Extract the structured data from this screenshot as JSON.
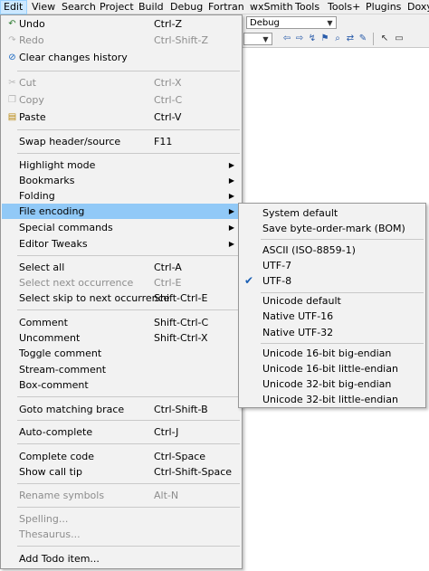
{
  "menubar": {
    "items": [
      "Edit",
      "View",
      "Search",
      "Project",
      "Build",
      "Debug",
      "Fortran",
      "wxSmith",
      "Tools",
      "Tools+",
      "Plugins",
      "Doxy"
    ]
  },
  "toolbar": {
    "build_target": "Debug"
  },
  "edit_menu": {
    "items": [
      {
        "label": "Undo",
        "shortcut": "Ctrl-Z",
        "icon": "undo-icon",
        "enabled": true
      },
      {
        "label": "Redo",
        "shortcut": "Ctrl-Shift-Z",
        "icon": "redo-icon",
        "enabled": false
      },
      {
        "label": "Clear changes history",
        "shortcut": "",
        "icon": "clear-history-icon",
        "enabled": true
      },
      {
        "label": "Cut",
        "shortcut": "Ctrl-X",
        "icon": "cut-icon",
        "enabled": false
      },
      {
        "label": "Copy",
        "shortcut": "Ctrl-C",
        "icon": "copy-icon",
        "enabled": false
      },
      {
        "label": "Paste",
        "shortcut": "Ctrl-V",
        "icon": "paste-icon",
        "enabled": true
      },
      {
        "label": "Swap header/source",
        "shortcut": "F11",
        "enabled": true
      },
      {
        "label": "Highlight mode",
        "shortcut": "",
        "enabled": true,
        "submenu": true
      },
      {
        "label": "Bookmarks",
        "shortcut": "",
        "enabled": true,
        "submenu": true
      },
      {
        "label": "Folding",
        "shortcut": "",
        "enabled": true,
        "submenu": true
      },
      {
        "label": "File encoding",
        "shortcut": "",
        "enabled": true,
        "submenu": true,
        "highlighted": true
      },
      {
        "label": "Special commands",
        "shortcut": "",
        "enabled": true,
        "submenu": true
      },
      {
        "label": "Editor Tweaks",
        "shortcut": "",
        "enabled": true,
        "submenu": true
      },
      {
        "label": "Select all",
        "shortcut": "Ctrl-A",
        "enabled": true
      },
      {
        "label": "Select next occurrence",
        "shortcut": "Ctrl-E",
        "enabled": false
      },
      {
        "label": "Select skip to next occurrence",
        "shortcut": "Shift-Ctrl-E",
        "enabled": true
      },
      {
        "label": "Comment",
        "shortcut": "Shift-Ctrl-C",
        "enabled": true
      },
      {
        "label": "Uncomment",
        "shortcut": "Shift-Ctrl-X",
        "enabled": true
      },
      {
        "label": "Toggle comment",
        "shortcut": "",
        "enabled": true
      },
      {
        "label": "Stream-comment",
        "shortcut": "",
        "enabled": true
      },
      {
        "label": "Box-comment",
        "shortcut": "",
        "enabled": true
      },
      {
        "label": "Goto matching brace",
        "shortcut": "Ctrl-Shift-B",
        "enabled": true
      },
      {
        "label": "Auto-complete",
        "shortcut": "Ctrl-J",
        "enabled": true
      },
      {
        "label": "Complete code",
        "shortcut": "Ctrl-Space",
        "enabled": true
      },
      {
        "label": "Show call tip",
        "shortcut": "Ctrl-Shift-Space",
        "enabled": true
      },
      {
        "label": "Rename symbols",
        "shortcut": "Alt-N",
        "enabled": false
      },
      {
        "label": "Spelling...",
        "shortcut": "",
        "enabled": false
      },
      {
        "label": "Thesaurus...",
        "shortcut": "",
        "enabled": false
      },
      {
        "label": "Add Todo item...",
        "shortcut": "",
        "enabled": true
      }
    ]
  },
  "encoding_menu": {
    "items": [
      {
        "label": "System default",
        "checked": false
      },
      {
        "label": "Save byte-order-mark (BOM)",
        "checked": false
      },
      {
        "label": "ASCII (ISO-8859-1)",
        "checked": false
      },
      {
        "label": "UTF-7",
        "checked": false
      },
      {
        "label": "UTF-8",
        "checked": true
      },
      {
        "label": "Unicode default",
        "checked": false
      },
      {
        "label": "Native UTF-16",
        "checked": false
      },
      {
        "label": "Native UTF-32",
        "checked": false
      },
      {
        "label": "Unicode 16-bit big-endian",
        "checked": false
      },
      {
        "label": "Unicode 16-bit little-endian",
        "checked": false
      },
      {
        "label": "Unicode 32-bit big-endian",
        "checked": false
      },
      {
        "label": "Unicode 32-bit little-endian",
        "checked": false
      }
    ]
  },
  "colors": {
    "menu_bg": "#f2f2f2",
    "highlight": "#91c9f7",
    "disabled_text": "#8d8d8d",
    "check": "#1a5fb4"
  }
}
